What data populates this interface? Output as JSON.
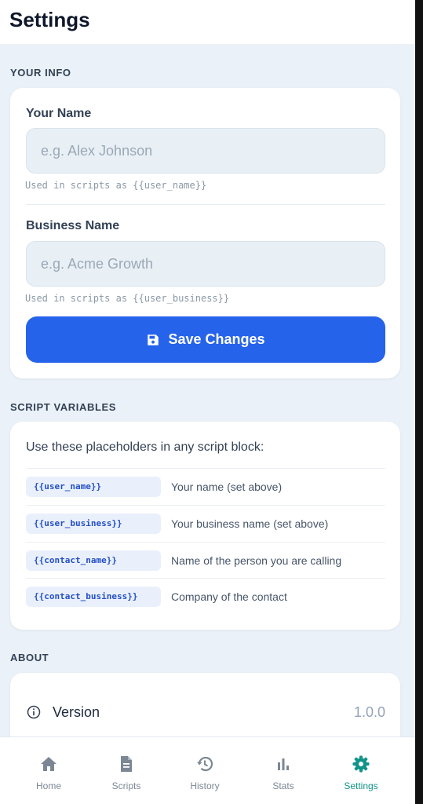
{
  "header": {
    "title": "Settings"
  },
  "your_info": {
    "section_label": "YOUR INFO",
    "name_label": "Your Name",
    "name_placeholder": "e.g. Alex Johnson",
    "name_value": "",
    "name_hint": "Used in scripts as {{user_name}}",
    "business_label": "Business Name",
    "business_placeholder": "e.g. Acme Growth",
    "business_value": "",
    "business_hint": "Used in scripts as {{user_business}}",
    "save_label": "Save Changes",
    "save_icon": "floppy-disk-icon"
  },
  "script_variables": {
    "section_label": "SCRIPT VARIABLES",
    "intro": "Use these placeholders in any script block:",
    "rows": [
      {
        "token": "{{user_name}}",
        "description": "Your name (set above)"
      },
      {
        "token": "{{user_business}}",
        "description": "Your business name (set above)"
      },
      {
        "token": "{{contact_name}}",
        "description": "Name of the person you are calling"
      },
      {
        "token": "{{contact_business}}",
        "description": "Company of the contact"
      }
    ]
  },
  "about": {
    "section_label": "ABOUT",
    "version_label": "Version",
    "version_value": "1.0.0",
    "version_icon": "info-icon"
  },
  "tab_bar": {
    "active": "Settings",
    "active_color": "#0f9488",
    "inactive_color": "#7b8794",
    "tabs": [
      {
        "label": "Home",
        "icon": "home-icon"
      },
      {
        "label": "Scripts",
        "icon": "document-icon"
      },
      {
        "label": "History",
        "icon": "history-icon"
      },
      {
        "label": "Stats",
        "icon": "bar-chart-icon"
      },
      {
        "label": "Settings",
        "icon": "gear-icon"
      }
    ]
  },
  "colors": {
    "accent": "#2563eb",
    "background": "#eaf1f8",
    "chip_text": "#2450c7"
  }
}
